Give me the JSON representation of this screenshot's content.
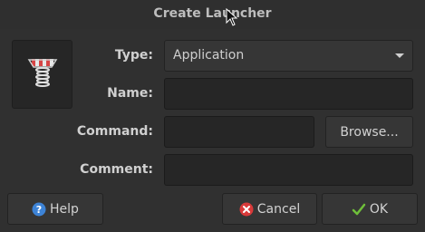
{
  "window": {
    "title": "Create Launcher"
  },
  "form": {
    "type_label": "Type:",
    "type_value": "Application",
    "name_label": "Name:",
    "name_value": "",
    "command_label": "Command:",
    "command_value": "",
    "browse_label": "Browse...",
    "comment_label": "Comment:",
    "comment_value": ""
  },
  "buttons": {
    "help_label": "Help",
    "cancel_label": "Cancel",
    "ok_label": "OK"
  },
  "icons": {
    "launcher": "launcher-spring-icon",
    "help": "help-icon",
    "cancel": "cancel-icon",
    "ok": "checkmark-icon"
  },
  "colors": {
    "help_blue": "#3d83d6",
    "cancel_red": "#d93a3a",
    "ok_green": "#6fbf3a"
  }
}
